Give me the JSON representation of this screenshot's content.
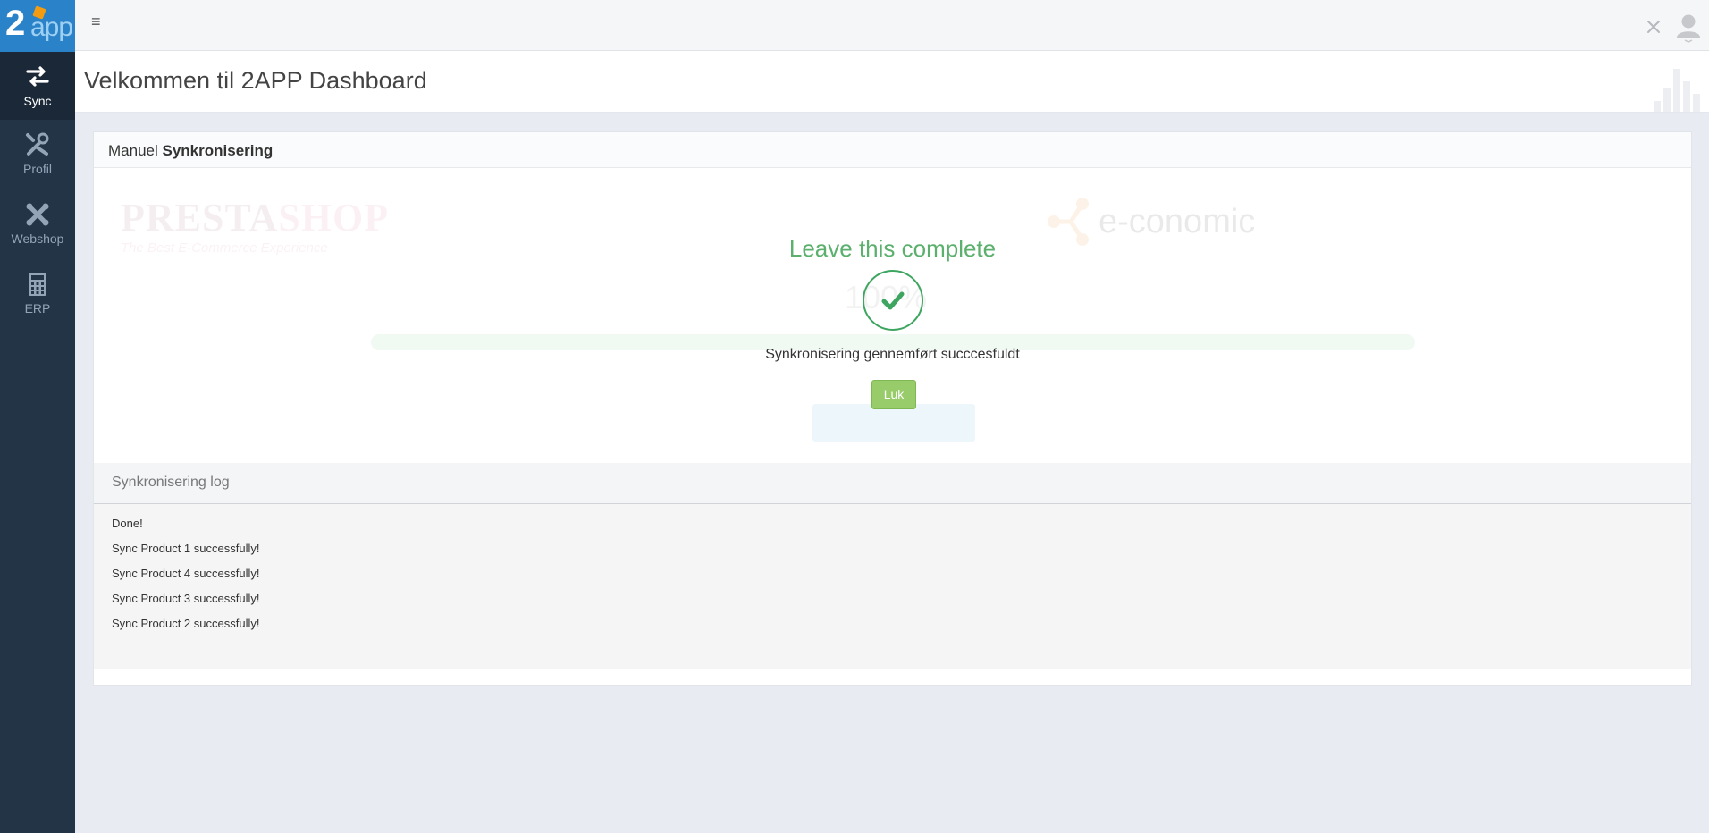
{
  "logo": {
    "main": "2",
    "suffix": "app"
  },
  "sidebar": {
    "items": [
      {
        "label": "Sync",
        "icon": "sync-arrows-icon",
        "active": true
      },
      {
        "label": "Profil",
        "icon": "wrench-icon",
        "active": false
      },
      {
        "label": "Webshop",
        "icon": "joomla-icon",
        "active": false
      },
      {
        "label": "ERP",
        "icon": "calculator-icon",
        "active": false
      }
    ]
  },
  "topbar": {
    "menu_icon": "≡"
  },
  "page": {
    "title": "Velkommen til 2APP Dashboard"
  },
  "panel": {
    "title_light": "Manuel",
    "title_bold": "Synkronisering",
    "logos": {
      "presta_name_a": "PRESTA",
      "presta_name_b": "SHOP",
      "presta_tagline": "The Best E-Commerce Experience",
      "economic": "e-conomic"
    },
    "background_percent": "100%",
    "modal": {
      "title": "Leave this complete",
      "message": "Synkronisering gennemført succcesfuldt",
      "close_button": "Luk"
    }
  },
  "log": {
    "title": "Synkronisering log",
    "lines": [
      "Done!",
      "Sync Product 1 successfully!",
      "Sync Product 4 successfully!",
      "Sync Product 3 successfully!",
      "Sync Product 2 successfully!"
    ]
  },
  "colors": {
    "sidebar": "#233447",
    "success": "#5cb06d",
    "button": "#98cc6a"
  }
}
